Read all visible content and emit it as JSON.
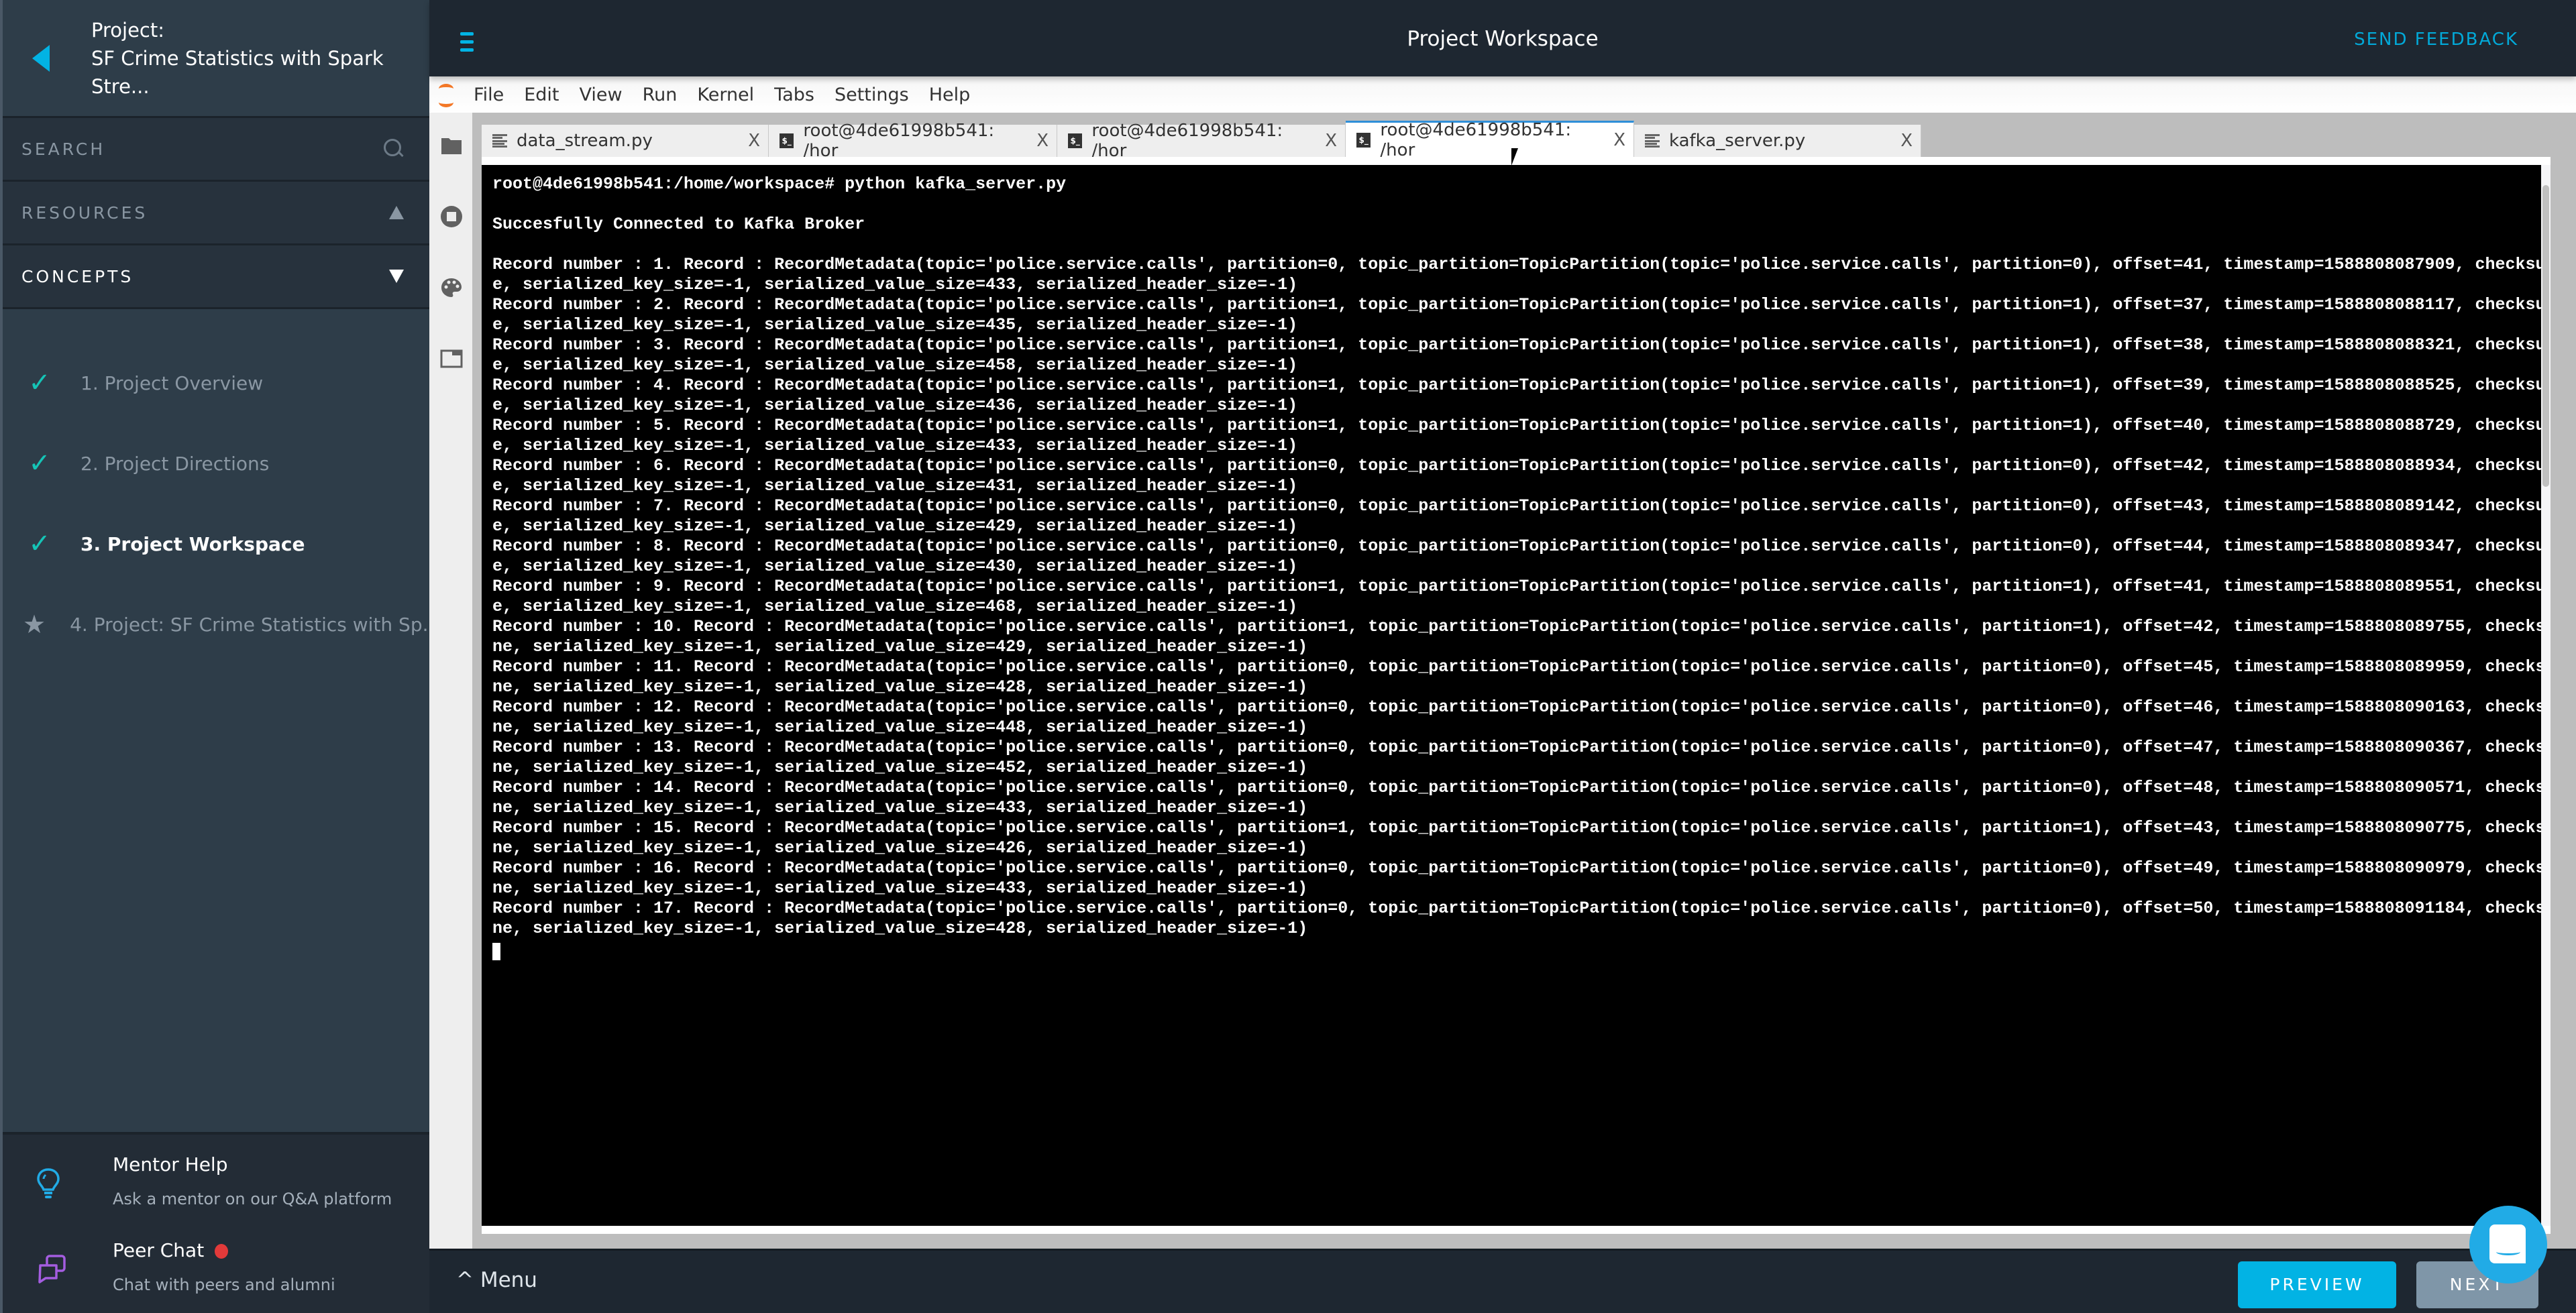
{
  "sidebar": {
    "project_label": "Project:",
    "project_name": "SF Crime Statistics with Spark Stre...",
    "search_label": "SEARCH",
    "resources_label": "RESOURCES",
    "concepts_label": "CONCEPTS",
    "concepts": [
      {
        "label": "1. Project Overview",
        "status": "completed",
        "icon": "check-icon"
      },
      {
        "label": "2. Project Directions",
        "status": "completed",
        "icon": "check-icon"
      },
      {
        "label": "3. Project Workspace",
        "status": "current",
        "icon": "check-icon"
      },
      {
        "label": "4. Project: SF Crime Statistics with Sp...",
        "status": "project",
        "icon": "star-icon"
      }
    ],
    "mentor_help": {
      "title": "Mentor Help",
      "subtitle": "Ask a mentor on our Q&A platform"
    },
    "peer_chat": {
      "title": "Peer Chat",
      "subtitle": "Chat with peers and alumni",
      "has_notification": true
    }
  },
  "header": {
    "title": "Project Workspace",
    "feedback_label": "SEND FEEDBACK"
  },
  "jupyter": {
    "menu": [
      "File",
      "Edit",
      "View",
      "Run",
      "Kernel",
      "Tabs",
      "Settings",
      "Help"
    ],
    "side_icons": [
      "folder-icon",
      "running-stop-icon",
      "palette-icon",
      "tabs-icon"
    ],
    "tabs": [
      {
        "label": "data_stream.py",
        "type": "file",
        "active": false
      },
      {
        "label": "root@4de61998b541: /hor",
        "type": "terminal",
        "active": false
      },
      {
        "label": "root@4de61998b541: /hor",
        "type": "terminal",
        "active": false
      },
      {
        "label": "root@4de61998b541: /hor",
        "type": "terminal",
        "active": true
      },
      {
        "label": "kafka_server.py",
        "type": "file",
        "active": false
      }
    ],
    "close_glyph": "X"
  },
  "terminal": {
    "prompt": "root@4de61998b541:/home/workspace# python kafka_server.py",
    "status": "Succesfully Connected to Kafka Broker",
    "topic": "police.service.calls",
    "records": [
      {
        "n": 1,
        "partition": 0,
        "offset": 41,
        "timestamp": 1588808087909,
        "value_size": 433
      },
      {
        "n": 2,
        "partition": 1,
        "offset": 37,
        "timestamp": 1588808088117,
        "value_size": 435
      },
      {
        "n": 3,
        "partition": 1,
        "offset": 38,
        "timestamp": 1588808088321,
        "value_size": 458
      },
      {
        "n": 4,
        "partition": 1,
        "offset": 39,
        "timestamp": 1588808088525,
        "value_size": 436
      },
      {
        "n": 5,
        "partition": 1,
        "offset": 40,
        "timestamp": 1588808088729,
        "value_size": 433
      },
      {
        "n": 6,
        "partition": 0,
        "offset": 42,
        "timestamp": 1588808088934,
        "value_size": 431
      },
      {
        "n": 7,
        "partition": 0,
        "offset": 43,
        "timestamp": 1588808089142,
        "value_size": 429
      },
      {
        "n": 8,
        "partition": 0,
        "offset": 44,
        "timestamp": 1588808089347,
        "value_size": 430
      },
      {
        "n": 9,
        "partition": 1,
        "offset": 41,
        "timestamp": 1588808089551,
        "value_size": 468
      },
      {
        "n": 10,
        "partition": 1,
        "offset": 42,
        "timestamp": 1588808089755,
        "value_size": 429
      },
      {
        "n": 11,
        "partition": 0,
        "offset": 45,
        "timestamp": 1588808089959,
        "value_size": 428
      },
      {
        "n": 12,
        "partition": 0,
        "offset": 46,
        "timestamp": 1588808090163,
        "value_size": 448
      },
      {
        "n": 13,
        "partition": 0,
        "offset": 47,
        "timestamp": 1588808090367,
        "value_size": 452
      },
      {
        "n": 14,
        "partition": 0,
        "offset": 48,
        "timestamp": 1588808090571,
        "value_size": 433
      },
      {
        "n": 15,
        "partition": 1,
        "offset": 43,
        "timestamp": 1588808090775,
        "value_size": 426
      },
      {
        "n": 16,
        "partition": 0,
        "offset": 49,
        "timestamp": 1588808090979,
        "value_size": 433
      },
      {
        "n": 17,
        "partition": 0,
        "offset": 50,
        "timestamp": 1588808091184,
        "value_size": 428
      }
    ]
  },
  "footer": {
    "menu_label": "Menu",
    "preview_label": "PREVIEW",
    "next_label": "NEXT"
  },
  "colors": {
    "accent": "#02b3e4",
    "check": "#15c4b6",
    "notification": "#e23a3a",
    "peer_chat_icon": "#a45de0",
    "jupyter_orange": "#f37726"
  }
}
